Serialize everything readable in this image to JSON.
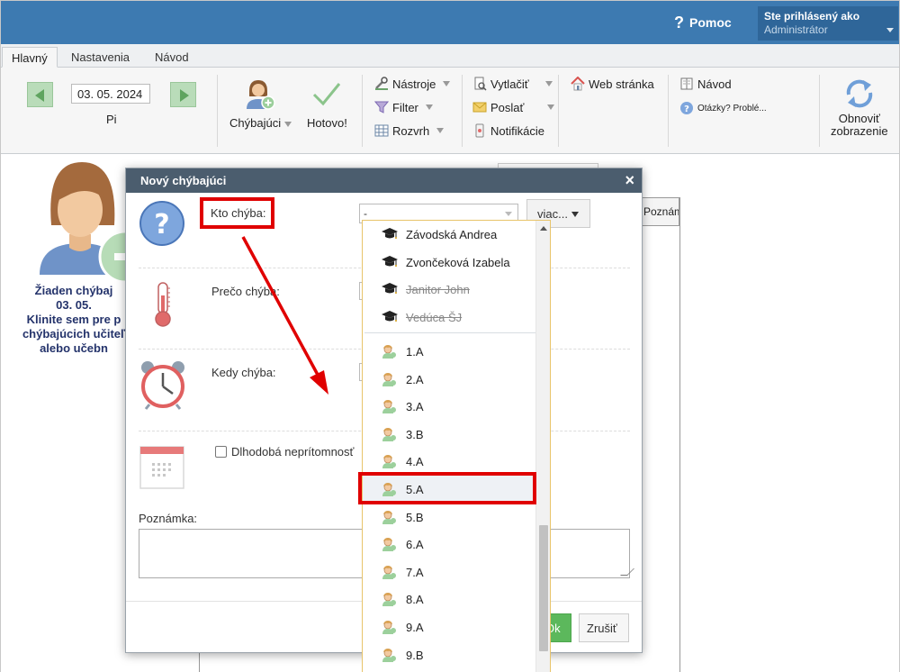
{
  "header": {
    "help_label": "Pomoc",
    "login_line1": "Ste prihlásený ako",
    "login_line2": "Administrátor"
  },
  "tabs": [
    {
      "label": "Hlavný",
      "active": true
    },
    {
      "label": "Nastavenia",
      "active": false
    },
    {
      "label": "Návod",
      "active": false
    }
  ],
  "ribbon": {
    "date_value": "03. 05. 2024",
    "day_label": "Pi",
    "absent_label": "Chýbajúci",
    "done_label": "Hotovo!",
    "tools_label": "Nástroje",
    "filter_label": "Filter",
    "schedule_label": "Rozvrh",
    "print_label": "Vytlačiť",
    "send_label": "Poslať",
    "notifications_label": "Notifikácie",
    "website_label": "Web stránka",
    "manual_label": "Návod",
    "questions_label": "Otázky? Problé...",
    "refresh_line1": "Obnoviť",
    "refresh_line2": "zobrazenie"
  },
  "background": {
    "info_lines": [
      "Žiaden chýbaj",
      "03. 05.",
      "Klinite sem pre p",
      "chýbajúcich učiteľ",
      "alebo učebn"
    ],
    "col_header": "Poznám"
  },
  "modal": {
    "title": "Nový chýbajúci",
    "close_glyph": "×",
    "who_label": "Kto chýba:",
    "who_value": "-",
    "more_label": "viac...",
    "why_label": "Prečo chýba:",
    "when_label": "Kedy chýba:",
    "longterm_label": "Dlhodobá neprítomnosť",
    "note_label": "Poznámka:",
    "ok_label": "Ok",
    "cancel_label": "Zrušiť"
  },
  "dropdown": {
    "people": [
      {
        "label": "Závodská Andrea",
        "struck": false
      },
      {
        "label": "Zvončeková Izabela",
        "struck": false
      },
      {
        "label": "Janitor John",
        "struck": true
      },
      {
        "label": "Vedúca ŠJ",
        "struck": true
      }
    ],
    "classes": [
      "1.A",
      "2.A",
      "3.A",
      "3.B",
      "4.A",
      "5.A",
      "5.B",
      "6.A",
      "7.A",
      "8.A",
      "9.A",
      "9.B"
    ],
    "highlighted": "5.A"
  },
  "colors": {
    "header_blue": "#3d7ab1",
    "modal_header": "#4b5d6e",
    "annotation_red": "#e00000",
    "ok_green": "#5cb85c"
  }
}
